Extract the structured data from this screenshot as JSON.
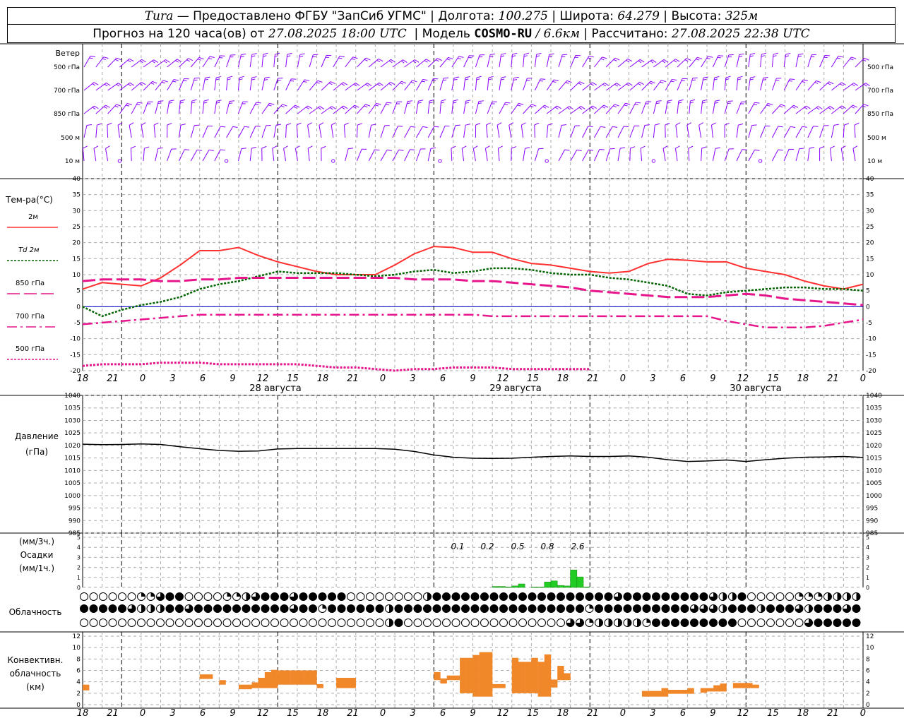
{
  "header": {
    "station": "Tura",
    "provider": "— Предоставлено ФГБУ \"ЗапСиб УГМС\"",
    "lon_label": "Долгота:",
    "lon_value": "100.275",
    "lat_label": "Широта:",
    "lat_value": "64.279",
    "alt_label": "Высота:",
    "alt_value": "325м",
    "forecast_label": "Прогноз на 120 часа(ов) от",
    "forecast_start": "27.08.2025 18:00 UTC",
    "model_label": "Модель",
    "model_name": "COSMO-RU",
    "model_res": "/ 6.6км",
    "calc_label": "Рассчитано:",
    "calc_time": "27.08.2025 22:38 UTC"
  },
  "time_axis": {
    "hour_labels": [
      "18",
      "21",
      "0",
      "3",
      "6",
      "9",
      "12",
      "15",
      "18",
      "21",
      "0",
      "3",
      "6",
      "9",
      "12",
      "15",
      "18",
      "21",
      "0",
      "3",
      "6",
      "9",
      "12",
      "15",
      "18",
      "21",
      "0"
    ],
    "day_labels": [
      "28 августа",
      "29 августа",
      "30 августа"
    ]
  },
  "wind": {
    "title": "Ветер",
    "levels": [
      "500 гПа",
      "700 гПа",
      "850 гПа",
      "500 м",
      "10  м"
    ],
    "barb_color": "#8B00FF"
  },
  "temperature": {
    "title": "Тем-ра(°С)",
    "legend": [
      {
        "label": "2м",
        "color": "#ff3030"
      },
      {
        "label": "Td  2м",
        "color": "#006400"
      },
      {
        "label": "850 гПа",
        "color": "#e6158c"
      },
      {
        "label": "700 гПа",
        "color": "#e6158c"
      },
      {
        "label": "500 гПа",
        "color": "#e6158c"
      }
    ],
    "yticks": [
      "40",
      "35",
      "30",
      "25",
      "20",
      "15",
      "10",
      "5",
      "0",
      "-5",
      "-10",
      "-15",
      "-20"
    ]
  },
  "pressure": {
    "title": "Давление",
    "unit": "(гПа)",
    "yticks": [
      "1040",
      "1035",
      "1030",
      "1025",
      "1020",
      "1015",
      "1010",
      "1005",
      "1000",
      "995",
      "990",
      "985"
    ]
  },
  "precip": {
    "unit1": "(мм/3ч.)",
    "title": "Осадки",
    "unit2": "(мм/1ч.)",
    "totals": [
      "0.1",
      "0.2",
      "0.5",
      "0.8",
      "2.6"
    ],
    "yticks": [
      "5",
      "4",
      "3",
      "2",
      "1",
      "0"
    ]
  },
  "clouds": {
    "title": "Облачность"
  },
  "convective": {
    "title1": "Конвективн.",
    "title2": "облачность",
    "unit": "(км)",
    "yticks": [
      "12",
      "10",
      "8",
      "6",
      "4",
      "2",
      "0"
    ],
    "color": "#f0882a"
  },
  "chart_data": [
    {
      "type": "line",
      "title": "Тем-ра(°С)",
      "ylim": [
        -20,
        40
      ],
      "x_hours_from_start": [
        0,
        3,
        6,
        9,
        12,
        15,
        18,
        21,
        24,
        27,
        30,
        33,
        36,
        39,
        42,
        45,
        48,
        51,
        54,
        57,
        60,
        63,
        66,
        69,
        72,
        75,
        78,
        81,
        84,
        87,
        90,
        93,
        96,
        99,
        102,
        105,
        108,
        111,
        114,
        117,
        120
      ],
      "series": [
        {
          "name": "2м",
          "values": [
            5.5,
            7.5,
            7,
            6.5,
            9,
            13,
            17.5,
            17.5,
            18.5,
            16,
            14,
            12.5,
            11,
            10,
            10,
            10,
            13,
            16.5,
            18.8,
            18.5,
            17,
            17,
            15,
            13.5,
            13,
            12,
            11,
            10.5,
            11,
            13.5,
            14.8,
            14.5,
            14,
            14,
            12,
            11,
            10,
            8,
            6.5,
            5.5,
            7
          ]
        },
        {
          "name": "Td  2м",
          "values": [
            0,
            -3,
            -1,
            0.5,
            1.5,
            3,
            5.5,
            7,
            8,
            9.5,
            11,
            10.5,
            10.5,
            10.5,
            10,
            9.5,
            10,
            11,
            11.5,
            10.5,
            11,
            12,
            12,
            11.5,
            10.5,
            10,
            10,
            9,
            8.5,
            7.5,
            6.5,
            4,
            3.5,
            4.5,
            5,
            5.5,
            6,
            6,
            5.5,
            5.5,
            5
          ]
        },
        {
          "name": "850 гПа",
          "values": [
            8,
            8.5,
            8.5,
            8.5,
            8,
            8,
            8.5,
            8.5,
            9,
            9,
            9,
            9,
            9,
            9,
            9,
            9,
            9,
            8.5,
            8.5,
            8.5,
            8,
            8,
            7.5,
            7,
            6.5,
            6,
            5,
            4.5,
            4,
            3.5,
            3,
            3,
            3,
            3.5,
            4,
            3.5,
            2.5,
            2,
            1.5,
            1,
            0.5
          ]
        },
        {
          "name": "700 гПа",
          "values": [
            -5.5,
            -5,
            -4.5,
            -4,
            -3.5,
            -3,
            -2.5,
            -2.5,
            -2.5,
            -2.5,
            -2.5,
            -2.5,
            -2.5,
            -2.5,
            -2.5,
            -2.5,
            -2.5,
            -2.5,
            -2.5,
            -2.5,
            -2.5,
            -3,
            -3,
            -3,
            -3,
            -3,
            -3,
            -3,
            -3,
            -3,
            -3,
            -3,
            -3,
            -4.5,
            -5.5,
            -6.5,
            -6.5,
            -6.5,
            -6,
            -5,
            -4
          ]
        },
        {
          "name": "500 гПа",
          "values": [
            -18.5,
            -18,
            -18,
            -18,
            -17.5,
            -17.5,
            -17.5,
            -18,
            -18,
            -18,
            -18,
            -18,
            -18.5,
            -19,
            -19,
            -19.5,
            -20,
            -19.5,
            -19.5,
            -19,
            -19,
            -19,
            -19.5,
            -19.5,
            -19.5,
            -19.5,
            -19.5
          ]
        }
      ]
    },
    {
      "type": "line",
      "title": "Давление",
      "ylim": [
        985,
        1040
      ],
      "x_hours_from_start": [
        0,
        3,
        6,
        9,
        12,
        15,
        18,
        21,
        24,
        27,
        30,
        33,
        36,
        39,
        42,
        45,
        48,
        51,
        54,
        57,
        60,
        63,
        66,
        69,
        72,
        75,
        78,
        81,
        84,
        87,
        90,
        93,
        96,
        99,
        102,
        105,
        108,
        111,
        114,
        117,
        120
      ],
      "series": [
        {
          "name": "Давление",
          "values": [
            1020.5,
            1020.3,
            1020.4,
            1020.6,
            1020.4,
            1019.5,
            1018.7,
            1018,
            1017.7,
            1017.8,
            1018.6,
            1018.8,
            1018.8,
            1018.8,
            1018.8,
            1018.8,
            1018.5,
            1017.6,
            1016.2,
            1015.3,
            1014.9,
            1014.8,
            1014.9,
            1015.3,
            1015.6,
            1015.8,
            1015.6,
            1015.6,
            1015.8,
            1015.3,
            1014.3,
            1013.6,
            1013.8,
            1014.2,
            1013.6,
            1014.3,
            1014.9,
            1015.3,
            1015.4,
            1015.6,
            1015.2
          ]
        }
      ]
    },
    {
      "type": "bar",
      "title": "Осадки",
      "ylim": [
        0,
        5
      ],
      "x_hours_from_start": [
        63,
        64,
        65,
        66,
        67,
        69,
        70,
        71,
        72,
        73,
        74,
        75,
        76,
        77
      ],
      "values": [
        0.1,
        0.1,
        0.05,
        0.15,
        0.35,
        0.05,
        0.05,
        0.55,
        0.65,
        0.2,
        0.15,
        1.75,
        1.05,
        0.05
      ]
    },
    {
      "type": "bar",
      "title": "Конвективн. облачность",
      "ylim": [
        0,
        12
      ],
      "bars": [
        {
          "x": 0,
          "bottom": 2.5,
          "top": 3.5
        },
        {
          "x": 18,
          "bottom": 4.5,
          "top": 5.3
        },
        {
          "x": 19,
          "bottom": 4.5,
          "top": 5.3
        },
        {
          "x": 21,
          "bottom": 3.5,
          "top": 4.3
        },
        {
          "x": 24,
          "bottom": 2.7,
          "top": 3.5
        },
        {
          "x": 25,
          "bottom": 2.7,
          "top": 3.5
        },
        {
          "x": 26,
          "bottom": 2.9,
          "top": 3.9
        },
        {
          "x": 27,
          "bottom": 2.9,
          "top": 4.7
        },
        {
          "x": 28,
          "bottom": 2.9,
          "top": 5.7
        },
        {
          "x": 29,
          "bottom": 2.9,
          "top": 6.1
        },
        {
          "x": 30,
          "bottom": 3.5,
          "top": 6.0
        },
        {
          "x": 31,
          "bottom": 3.5,
          "top": 6.0
        },
        {
          "x": 32,
          "bottom": 3.5,
          "top": 6.0
        },
        {
          "x": 33,
          "bottom": 3.5,
          "top": 6.0
        },
        {
          "x": 34,
          "bottom": 3.5,
          "top": 6.0
        },
        {
          "x": 35,
          "bottom": 3.5,
          "top": 6.0
        },
        {
          "x": 36,
          "bottom": 2.9,
          "top": 3.6
        },
        {
          "x": 39,
          "bottom": 2.9,
          "top": 4.7
        },
        {
          "x": 40,
          "bottom": 2.9,
          "top": 4.7
        },
        {
          "x": 41,
          "bottom": 2.9,
          "top": 4.7
        },
        {
          "x": 54,
          "bottom": 4.3,
          "top": 5.7
        },
        {
          "x": 55,
          "bottom": 3.7,
          "top": 4.6
        },
        {
          "x": 56,
          "bottom": 4.3,
          "top": 5.1
        },
        {
          "x": 57,
          "bottom": 4.3,
          "top": 5.1
        },
        {
          "x": 58,
          "bottom": 2.0,
          "top": 8.2
        },
        {
          "x": 59,
          "bottom": 2.0,
          "top": 8.2
        },
        {
          "x": 60,
          "bottom": 1.4,
          "top": 8.7
        },
        {
          "x": 61,
          "bottom": 1.4,
          "top": 9.2
        },
        {
          "x": 62,
          "bottom": 1.4,
          "top": 9.2
        },
        {
          "x": 63,
          "bottom": 2.9,
          "top": 3.6
        },
        {
          "x": 64,
          "bottom": 2.9,
          "top": 3.6
        },
        {
          "x": 66,
          "bottom": 2.0,
          "top": 8.2
        },
        {
          "x": 67,
          "bottom": 2.0,
          "top": 7.5
        },
        {
          "x": 68,
          "bottom": 2.0,
          "top": 7.5
        },
        {
          "x": 69,
          "bottom": 2.0,
          "top": 8.2
        },
        {
          "x": 70,
          "bottom": 1.4,
          "top": 7.5
        },
        {
          "x": 71,
          "bottom": 1.4,
          "top": 8.8
        },
        {
          "x": 72,
          "bottom": 3.0,
          "top": 4.4
        },
        {
          "x": 73,
          "bottom": 4.3,
          "top": 6.8
        },
        {
          "x": 74,
          "bottom": 4.3,
          "top": 5.5
        },
        {
          "x": 86,
          "bottom": 1.4,
          "top": 2.4
        },
        {
          "x": 87,
          "bottom": 1.4,
          "top": 2.4
        },
        {
          "x": 88,
          "bottom": 1.4,
          "top": 2.4
        },
        {
          "x": 89,
          "bottom": 1.4,
          "top": 2.9
        },
        {
          "x": 90,
          "bottom": 1.9,
          "top": 2.6
        },
        {
          "x": 91,
          "bottom": 1.9,
          "top": 2.6
        },
        {
          "x": 92,
          "bottom": 1.9,
          "top": 2.6
        },
        {
          "x": 93,
          "bottom": 1.9,
          "top": 2.9
        },
        {
          "x": 95,
          "bottom": 2.1,
          "top": 2.9
        },
        {
          "x": 96,
          "bottom": 2.3,
          "top": 2.9
        },
        {
          "x": 97,
          "bottom": 2.3,
          "top": 3.4
        },
        {
          "x": 98,
          "bottom": 2.3,
          "top": 3.7
        },
        {
          "x": 100,
          "bottom": 2.9,
          "top": 3.8
        },
        {
          "x": 101,
          "bottom": 2.9,
          "top": 3.8
        },
        {
          "x": 102,
          "bottom": 2.9,
          "top": 3.8
        },
        {
          "x": 103,
          "bottom": 2.9,
          "top": 3.5
        }
      ]
    }
  ]
}
